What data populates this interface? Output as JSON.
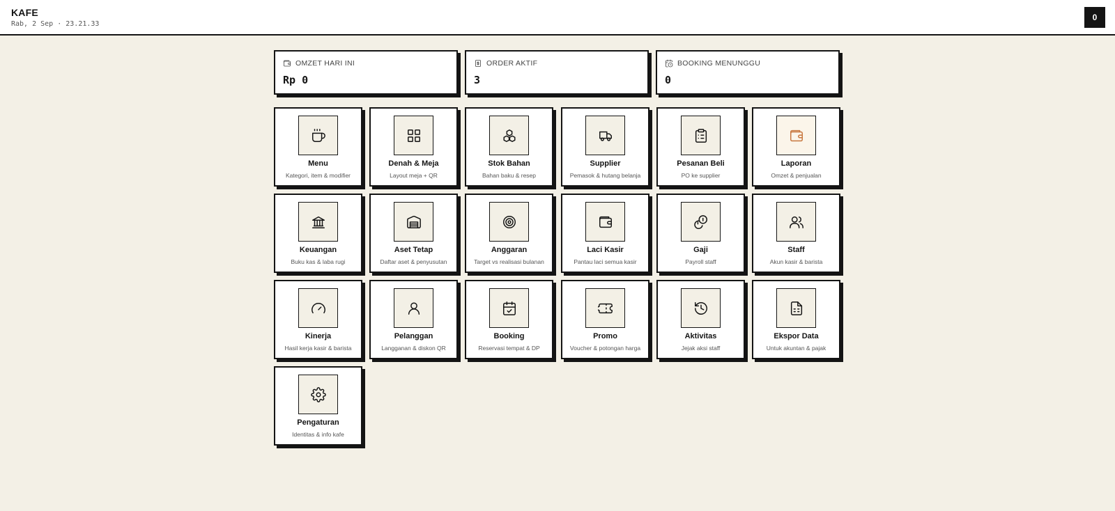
{
  "header": {
    "title": "KAFE",
    "datetime": "Rab, 2 Sep · 23.21.33",
    "badge": "0"
  },
  "stats": [
    {
      "label": "OMZET HARI INI",
      "value": "Rp 0",
      "icon": "wallet-icon"
    },
    {
      "label": "ORDER AKTIF",
      "value": "3",
      "icon": "receipt-icon"
    },
    {
      "label": "BOOKING MENUNGGU",
      "value": "0",
      "icon": "calendar-clock-icon"
    }
  ],
  "tiles": [
    {
      "title": "Menu",
      "subtitle": "Kategori, item & modifier",
      "icon": "coffee-icon"
    },
    {
      "title": "Denah & Meja",
      "subtitle": "Layout meja + QR",
      "icon": "grid-icon"
    },
    {
      "title": "Stok Bahan",
      "subtitle": "Bahan baku & resep",
      "icon": "boxes-icon"
    },
    {
      "title": "Supplier",
      "subtitle": "Pemasok & hutang belanja",
      "icon": "truck-icon"
    },
    {
      "title": "Pesanan Beli",
      "subtitle": "PO ke supplier",
      "icon": "clipboard-list-icon"
    },
    {
      "title": "Laporan",
      "subtitle": "Omzet & penjualan",
      "icon": "wallet-icon",
      "accent": "#c8773f"
    },
    {
      "title": "Keuangan",
      "subtitle": "Buku kas & laba rugi",
      "icon": "bank-icon"
    },
    {
      "title": "Aset Tetap",
      "subtitle": "Daftar aset & penyusutan",
      "icon": "warehouse-icon"
    },
    {
      "title": "Anggaran",
      "subtitle": "Target vs realisasi bulanan",
      "icon": "target-icon"
    },
    {
      "title": "Laci Kasir",
      "subtitle": "Pantau laci semua kasir",
      "icon": "cash-drawer-icon"
    },
    {
      "title": "Gaji",
      "subtitle": "Payroll staff",
      "icon": "coins-icon"
    },
    {
      "title": "Staff",
      "subtitle": "Akun kasir & barista",
      "icon": "users-icon"
    },
    {
      "title": "Kinerja",
      "subtitle": "Hasil kerja kasir & barista",
      "icon": "gauge-icon"
    },
    {
      "title": "Pelanggan",
      "subtitle": "Langganan & diskon QR",
      "icon": "user-icon"
    },
    {
      "title": "Booking",
      "subtitle": "Reservasi tempat & DP",
      "icon": "calendar-check-icon"
    },
    {
      "title": "Promo",
      "subtitle": "Voucher & potongan harga",
      "icon": "ticket-icon"
    },
    {
      "title": "Aktivitas",
      "subtitle": "Jejak aksi staff",
      "icon": "history-icon"
    },
    {
      "title": "Ekspor Data",
      "subtitle": "Untuk akuntan & pajak",
      "icon": "file-spreadsheet-icon"
    },
    {
      "title": "Pengaturan",
      "subtitle": "Identitas & info kafe",
      "icon": "gear-icon"
    }
  ]
}
